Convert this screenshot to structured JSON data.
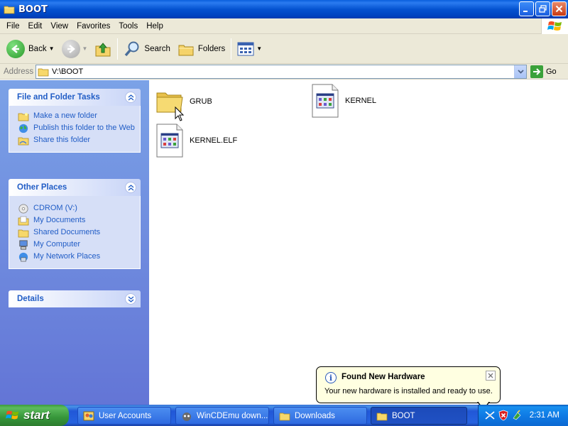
{
  "window": {
    "title": "BOOT",
    "minimize_icon": "minimize-icon",
    "maximize_icon": "restore-icon",
    "close_icon": "close-icon"
  },
  "menu": [
    "File",
    "Edit",
    "View",
    "Favorites",
    "Tools",
    "Help"
  ],
  "toolbar": {
    "back_label": "Back",
    "search_label": "Search",
    "folders_label": "Folders"
  },
  "address": {
    "label": "Address",
    "value": "V:\\BOOT",
    "go_label": "Go"
  },
  "tasks_panel": {
    "title": "File and Folder Tasks",
    "items": [
      {
        "label": "Make a new folder",
        "icon": "new-folder-icon"
      },
      {
        "label": "Publish this folder to the Web",
        "icon": "publish-web-icon"
      },
      {
        "label": "Share this folder",
        "icon": "share-folder-icon"
      }
    ]
  },
  "places_panel": {
    "title": "Other Places",
    "items": [
      {
        "label": "CDROM (V:)",
        "icon": "cdrom-icon"
      },
      {
        "label": "My Documents",
        "icon": "my-documents-icon"
      },
      {
        "label": "Shared Documents",
        "icon": "shared-documents-icon"
      },
      {
        "label": "My Computer",
        "icon": "my-computer-icon"
      },
      {
        "label": "My Network Places",
        "icon": "network-places-icon"
      }
    ]
  },
  "details_panel": {
    "title": "Details"
  },
  "files": [
    {
      "name": "GRUB",
      "type": "folder"
    },
    {
      "name": "KERNEL",
      "type": "file"
    },
    {
      "name": "KERNEL.ELF",
      "type": "file"
    }
  ],
  "taskbar": {
    "start_label": "start",
    "tasks": [
      {
        "label": "User Accounts",
        "icon": "user-accounts-icon",
        "active": false
      },
      {
        "label": "WinCDEmu down...",
        "icon": "wincdemu-icon",
        "active": false
      },
      {
        "label": "Downloads",
        "icon": "folder-icon",
        "active": false
      },
      {
        "label": "BOOT",
        "icon": "folder-icon",
        "active": true
      }
    ],
    "clock": "2:31 AM"
  },
  "balloon": {
    "title": "Found New Hardware",
    "text": "Your new hardware is installed and ready to use."
  },
  "colors": {
    "titlebar": "#0553d0",
    "taskpane": "#7ba2e7",
    "link": "#215dc6",
    "start": "#36963a"
  }
}
